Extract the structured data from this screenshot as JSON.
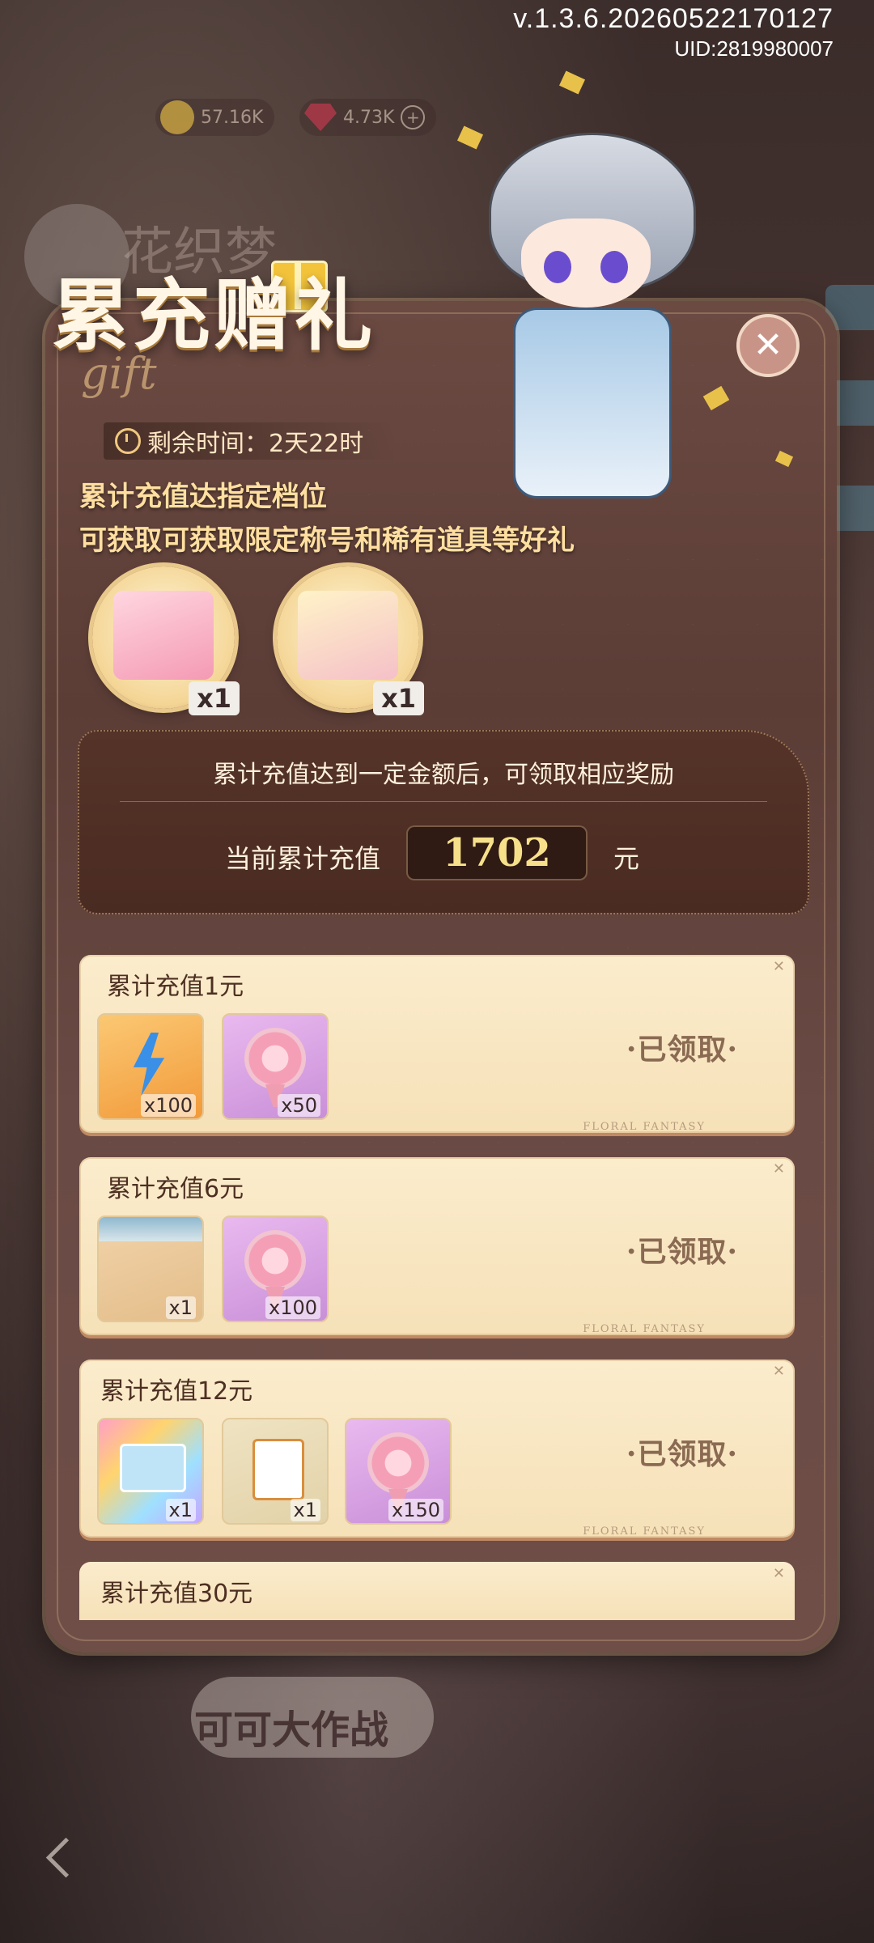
{
  "system": {
    "version": "v.1.3.6.20260522170127",
    "uid": "UID:2819980007"
  },
  "currency": {
    "gold": "57.16K",
    "gems": "4.73K"
  },
  "panel": {
    "title": "累充赠礼",
    "subtitle_script": "gift",
    "remaining_label": "剩余时间：2天22时",
    "desc_line1": "累计充值达指定档位",
    "desc_line2": "可获取可获取限定称号和稀有道具等好礼",
    "featured_rewards": [
      {
        "icon": "pink-bed-icon",
        "count": "x1"
      },
      {
        "icon": "cupid-card-icon",
        "count": "x1"
      }
    ],
    "progress": {
      "hint": "累计充值达到一定金额后，可领取相应奖励",
      "label": "当前累计充值",
      "value": "1702",
      "unit": "元"
    },
    "tiers": [
      {
        "title": "累计充值1元",
        "status": "·已领取·",
        "items": [
          {
            "icon": "energy-bolt-icon",
            "count": "x100",
            "style": "orange"
          },
          {
            "icon": "rose-bouquet-icon",
            "count": "x50",
            "style": "purple"
          }
        ]
      },
      {
        "title": "累计充值6元",
        "status": "·已领取·",
        "items": [
          {
            "icon": "beach-background-icon",
            "count": "x1",
            "style": "sand"
          },
          {
            "icon": "rose-bouquet-icon",
            "count": "x100",
            "style": "purple"
          }
        ]
      },
      {
        "title": "累计充值12元",
        "status": "·已领取·",
        "items": [
          {
            "icon": "letter-envelope-icon",
            "count": "x1",
            "style": "rainbow"
          },
          {
            "icon": "calendar-icon",
            "count": "x1",
            "style": "beige"
          },
          {
            "icon": "rose-bouquet-icon",
            "count": "x150",
            "style": "purple"
          }
        ]
      },
      {
        "title": "累计充值30元"
      }
    ],
    "floral_mark": "FLORAL  FANTASY"
  },
  "background": {
    "game_title_faded": "花织梦",
    "bottom_button": "可可大作战"
  }
}
